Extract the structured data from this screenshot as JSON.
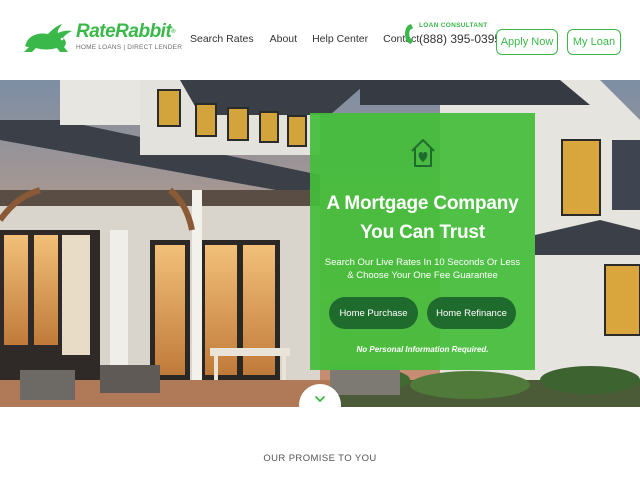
{
  "brand": {
    "name": "RateRabbit",
    "trademark": "®",
    "tagline": "HOME LOANS | DIRECT LENDER",
    "color": "#3bb84a"
  },
  "nav": {
    "items": [
      "Search Rates",
      "About",
      "Help Center",
      "Contact"
    ]
  },
  "consultant": {
    "label": "LOAN CONSULTANT",
    "phone": "(888) 395-0395",
    "icon": "phone-icon"
  },
  "header_buttons": {
    "apply": "Apply Now",
    "login": "My Loan"
  },
  "hero": {
    "icon": "house-heart-icon",
    "title_line1": "A Mortgage Company",
    "title_line2": "You Can Trust",
    "subtitle_line1": "Search Our Live Rates In 10 Seconds Or Less",
    "subtitle_line2": "& Choose Your One Fee Guarantee",
    "btn_purchase": "Home Purchase",
    "btn_refinance": "Home Refinance",
    "note": "No Personal Information Required.",
    "panel_color": "#44be3a",
    "button_color": "#1f6b2e"
  },
  "scroll": {
    "icon": "chevron-down-icon"
  },
  "section": {
    "heading": "OUR PROMISE TO YOU"
  }
}
